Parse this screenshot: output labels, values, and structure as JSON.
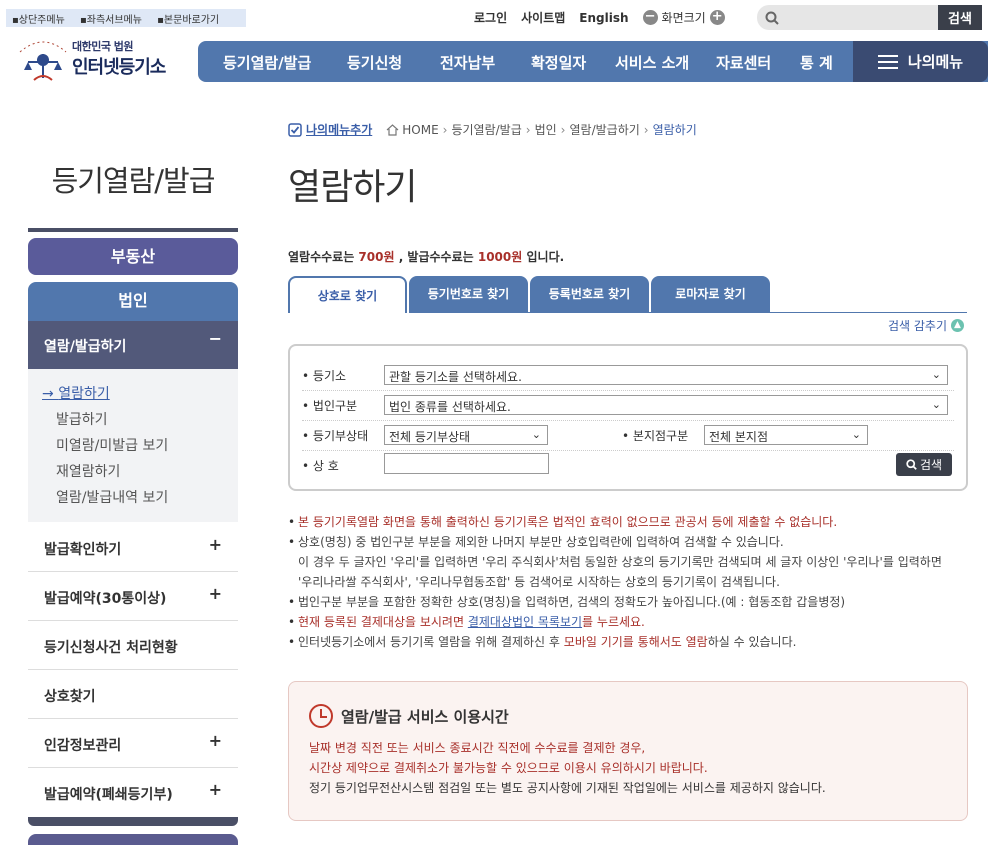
{
  "skip_links": [
    "상단주메뉴",
    "좌측서브메뉴",
    "본문바로가기"
  ],
  "util": {
    "login": "로그인",
    "sitemap": "사이트맵",
    "english": "English",
    "screen_size": "화면크기",
    "minus": "−",
    "plus": "+"
  },
  "search": {
    "placeholder": "",
    "button": "검색"
  },
  "logo": {
    "org": "대한민국 법원",
    "site": "인터넷등기소"
  },
  "gnb": [
    "등기열람/발급",
    "등기신청",
    "전자납부",
    "확정일자",
    "서비스 소개",
    "자료센터",
    "통 계"
  ],
  "my_menu": "나의메뉴",
  "lnb": {
    "title": "등기열람/발급",
    "cat1": "부동산",
    "cat2": "법인",
    "active": "열람/발급하기",
    "active_sym": "−",
    "sub": [
      "열람하기",
      "발급하기",
      "미열람/미발급 보기",
      "재열람하기",
      "열람/발급내역 보기"
    ],
    "items": [
      {
        "label": "발급확인하기",
        "sym": "+"
      },
      {
        "label": "발급예약(30통이상)",
        "sym": "+"
      },
      {
        "label": "등기신청사건 처리현황",
        "sym": ""
      },
      {
        "label": "상호찾기",
        "sym": ""
      },
      {
        "label": "인감정보관리",
        "sym": "+"
      },
      {
        "label": "발급예약(폐쇄등기부)",
        "sym": "+"
      }
    ]
  },
  "breadcrumb": {
    "add": "나의메뉴추가",
    "home": "HOME",
    "path": [
      "등기열람/발급",
      "법인",
      "열람/발급하기"
    ],
    "current": "열람하기"
  },
  "page_title": "열람하기",
  "fee": {
    "p1": "열람수수료는 ",
    "v1": "700원",
    "p2": " , 발급수수료는 ",
    "v2": "1000원",
    "p3": " 입니다."
  },
  "tabs": [
    "상호로 찾기",
    "등기번호로 찾기",
    "등록번호로 찾기",
    "로마자로 찾기"
  ],
  "fold": "검색 감추기",
  "form": {
    "registry_label": "등기소",
    "registry_value": "관할 등기소를 선택하세요.",
    "corp_type_label": "법인구분",
    "corp_type_value": "법인 종류를 선택하세요.",
    "status_label": "등기부상태",
    "status_value": "전체 등기부상태",
    "branch_label": "본지점구분",
    "branch_value": "전체 본지점",
    "name_label": "상 호",
    "name_value": "",
    "search_button": "검색"
  },
  "notes": {
    "n1": "본 등기기록열람 화면을 통해 출력하신 등기기록은 법적인 효력이 없으므로 관공서 등에 제출할 수 없습니다.",
    "n2": "상호(명칭) 중 법인구분 부분을 제외한 나머지 부분만 상호입력란에 입력하여 검색할 수 있습니다.",
    "n2b": "이 경우 두 글자인 '우리'를 입력하면 '우리 주식회사'처럼 동일한 상호의 등기기록만 검색되며 세 글자 이상인 '우리나'를 입력하면",
    "n2c": "'우리나라쌀 주식회사', '우리나무협동조합' 등 검색어로 시작하는 상호의 등기기록이 검색됩니다.",
    "n3": "법인구분 부분을 포함한 정확한 상호(명칭)을 입력하면, 검색의 정확도가 높아집니다.(예 : 협동조합 갑을병정)",
    "n4a": "현재 등록된 결제대상을 보시려면 ",
    "n4b": "결제대상법인 목록보기",
    "n4c": "를 누르세요.",
    "n5a": "인터넷등기소에서 등기기록 열람을 위해 결제하신 후 ",
    "n5b": "모바일 기기를 통해서도 열람",
    "n5c": "하실 수 있습니다."
  },
  "service": {
    "title": "열람/발급 서비스 이용시간",
    "l1": "날짜 변경 직전 또는 서비스 종료시간 직전에 수수료를 결제한 경우,",
    "l2": "시간상 제약으로 결제취소가 불가능할 수 있으므로 이용시 유의하시기 바랍니다.",
    "l3": "정기 등기업무전산시스템 점검일 또는 별도 공지사항에 기재된 작업일에는 서비스를 제공하지 않습니다."
  }
}
